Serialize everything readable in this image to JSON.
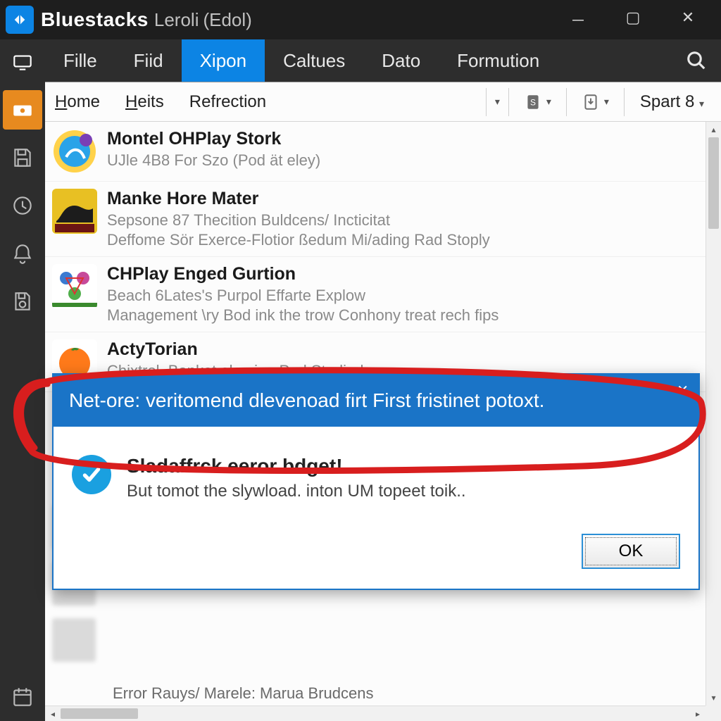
{
  "titlebar": {
    "app_name": "Bluestacks",
    "subtitle": "Leroli",
    "paren": "(Edol)"
  },
  "menubar": {
    "items": [
      "Fille",
      "Fiid",
      "Xipon",
      "Caltues",
      "Dato",
      "Formution"
    ],
    "active_index": 2
  },
  "subtabs": {
    "items": [
      {
        "underline": "H",
        "rest": "ome"
      },
      {
        "underline": "H",
        "rest": "eits"
      },
      {
        "underline": "",
        "rest": "Refrection"
      }
    ],
    "spart_label": "Spart 8"
  },
  "list": [
    {
      "title": "Montel OHPlay Stork",
      "lines": [
        "UJle 4B8 For Szo (Pod ät eley)"
      ]
    },
    {
      "title": "Manke Hore Mater",
      "lines": [
        "Sepsone 87 Thecition Buldcens/ Incticitat",
        "Deffome Sör Exerce-Flotior ßedum Mi/ading Rad Stoply"
      ]
    },
    {
      "title": "CHPlay Enged Gurtion",
      "lines": [
        "Beach 6Lates's Purpol Effarte Explow",
        "Management \\ry Bod ink the trow Conhony treat rech fips"
      ]
    },
    {
      "title": "ActyTorian",
      "lines": [
        "Chixtrol, Banket olemion Pud Studiral"
      ]
    }
  ],
  "dialog": {
    "header": "Net-ore: veritomend dlevenoad firt First fristinet potoxt.",
    "msg_title": "Sladaffrck eeror bdget!",
    "msg_body": "But tomot the slywload. inton UM topeet toik..",
    "ok_label": "OK"
  },
  "bottom_faint": {
    "line1": "Error Rauys/ Marele: Marua Brudcens"
  }
}
